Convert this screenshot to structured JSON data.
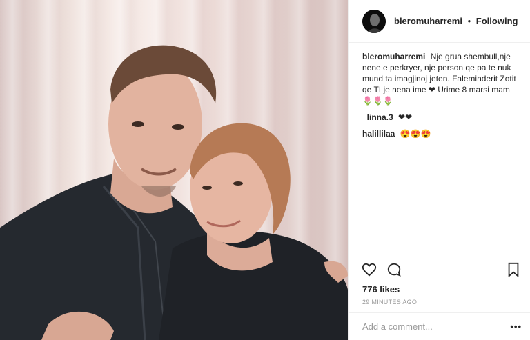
{
  "post": {
    "author": "bleromuharremi",
    "separator": "•",
    "follow_status": "Following",
    "caption": "Nje grua shembull,nje nene e perkryer, nje person qe pa te nuk mund ta imagjinoj jeten. Faleminderit Zotit qe TI je nena ime ❤ Urime 8 marsi mam 🌷🌷🌷",
    "comments": [
      {
        "user": "_linna.3",
        "text": "❤❤"
      },
      {
        "user": "halillilaa",
        "text": "😍😍😍"
      }
    ],
    "likes": "776 likes",
    "time": "29 MINUTES AGO",
    "add_comment_placeholder": "Add a comment...",
    "more_label": "•••"
  },
  "icons": {
    "like": "heart-icon",
    "comment": "comment-icon",
    "save": "bookmark-icon"
  }
}
